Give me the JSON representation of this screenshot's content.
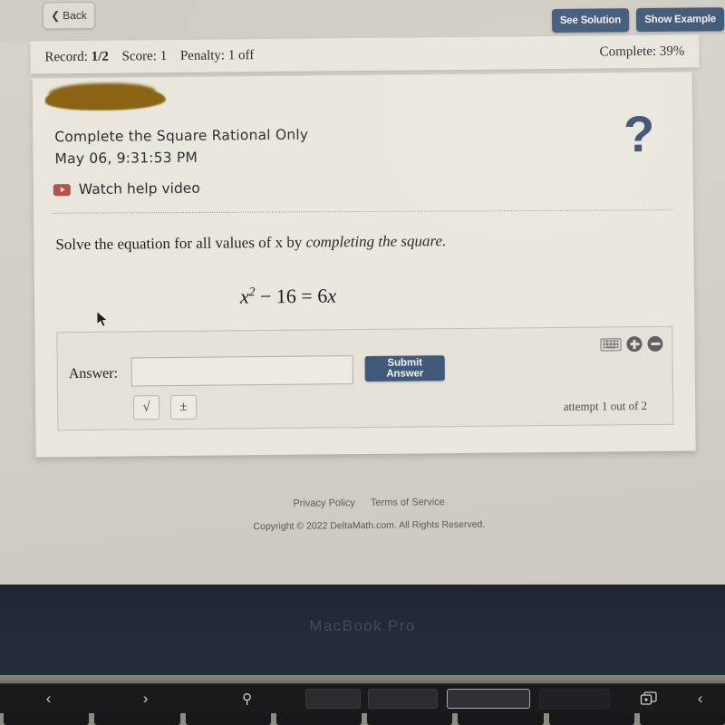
{
  "browser": {
    "back_label": "Back",
    "back_icon": "chevron-left-icon"
  },
  "header": {
    "see_solution_label": "See Solution",
    "show_example_label": "Show Example"
  },
  "status": {
    "record_label": "Record:",
    "record_value": "1/2",
    "score_label": "Score:",
    "score_value": "1",
    "penalty_label": "Penalty:",
    "penalty_value": "1 off",
    "complete_label": "Complete: 39%"
  },
  "assignment": {
    "redacted_name": "",
    "title": "Complete the Square Rational Only",
    "date": "May 06, 9:31:53 PM",
    "video_label": "Watch help video",
    "help_symbol": "?"
  },
  "question": {
    "prompt_prefix": "Solve the equation for all values of x by ",
    "prompt_emphasis": "completing the square.",
    "equation_lhs_base": "x",
    "equation_exponent": "2",
    "equation_rest": " − 16 = 6",
    "equation_var": "x"
  },
  "answer": {
    "label": "Answer:",
    "input_value": "",
    "input_placeholder": "",
    "submit_label": "Submit Answer",
    "sqrt_label": "√",
    "plusminus_label": "±",
    "attempt_text": "attempt 1 out of 2"
  },
  "footer": {
    "privacy_label": "Privacy Policy",
    "terms_label": "Terms of Service",
    "copyright": "Copyright © 2022 DeltaMath.com. All Rights Reserved."
  },
  "device": {
    "brand_label": "MacBook Pro",
    "touchbar_back": "‹",
    "touchbar_forward": "›",
    "touchbar_search": "⚲",
    "touchbar_newtab": "new-tab-icon",
    "touchbar_chevron": "‹"
  },
  "colors": {
    "accent_blue": "#3c5577",
    "redaction_brown": "#8a6414",
    "youtube_red": "#b8504c",
    "page_bg": "#d4d1c8",
    "card_bg": "#e9e6dd"
  }
}
